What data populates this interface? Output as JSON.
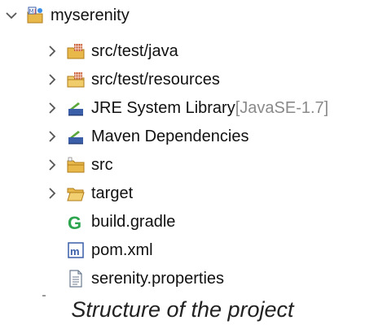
{
  "tree": {
    "project": {
      "label": "myserenity",
      "icon": "maven-project-icon",
      "expanded": true
    },
    "children": [
      {
        "label": "src/test/java",
        "decoration": "",
        "icon": "source-folder-package-icon",
        "expandable": true
      },
      {
        "label": "src/test/resources",
        "decoration": "",
        "icon": "resource-folder-icon",
        "expandable": true
      },
      {
        "label": "JRE System Library ",
        "decoration": "[JavaSE-1.7]",
        "icon": "library-icon",
        "expandable": true
      },
      {
        "label": "Maven Dependencies",
        "decoration": "",
        "icon": "library-icon",
        "expandable": true
      },
      {
        "label": "src",
        "decoration": "",
        "icon": "folder-icon",
        "expandable": true
      },
      {
        "label": "target",
        "decoration": "",
        "icon": "folder-open-icon",
        "expandable": true
      },
      {
        "label": "build.gradle",
        "decoration": "",
        "icon": "gradle-icon",
        "expandable": false
      },
      {
        "label": "pom.xml",
        "decoration": "",
        "icon": "maven-pom-icon",
        "expandable": false
      },
      {
        "label": "serenity.properties",
        "decoration": "",
        "icon": "text-file-icon",
        "expandable": false
      }
    ]
  },
  "caption": "Structure of the project",
  "colors": {
    "folder": "#e8b84a",
    "library_blue": "#3a5ea8",
    "library_green": "#5aa83a",
    "gradle_green": "#2da44e",
    "chevron": "#555555",
    "decoration": "#8a8a8a"
  }
}
